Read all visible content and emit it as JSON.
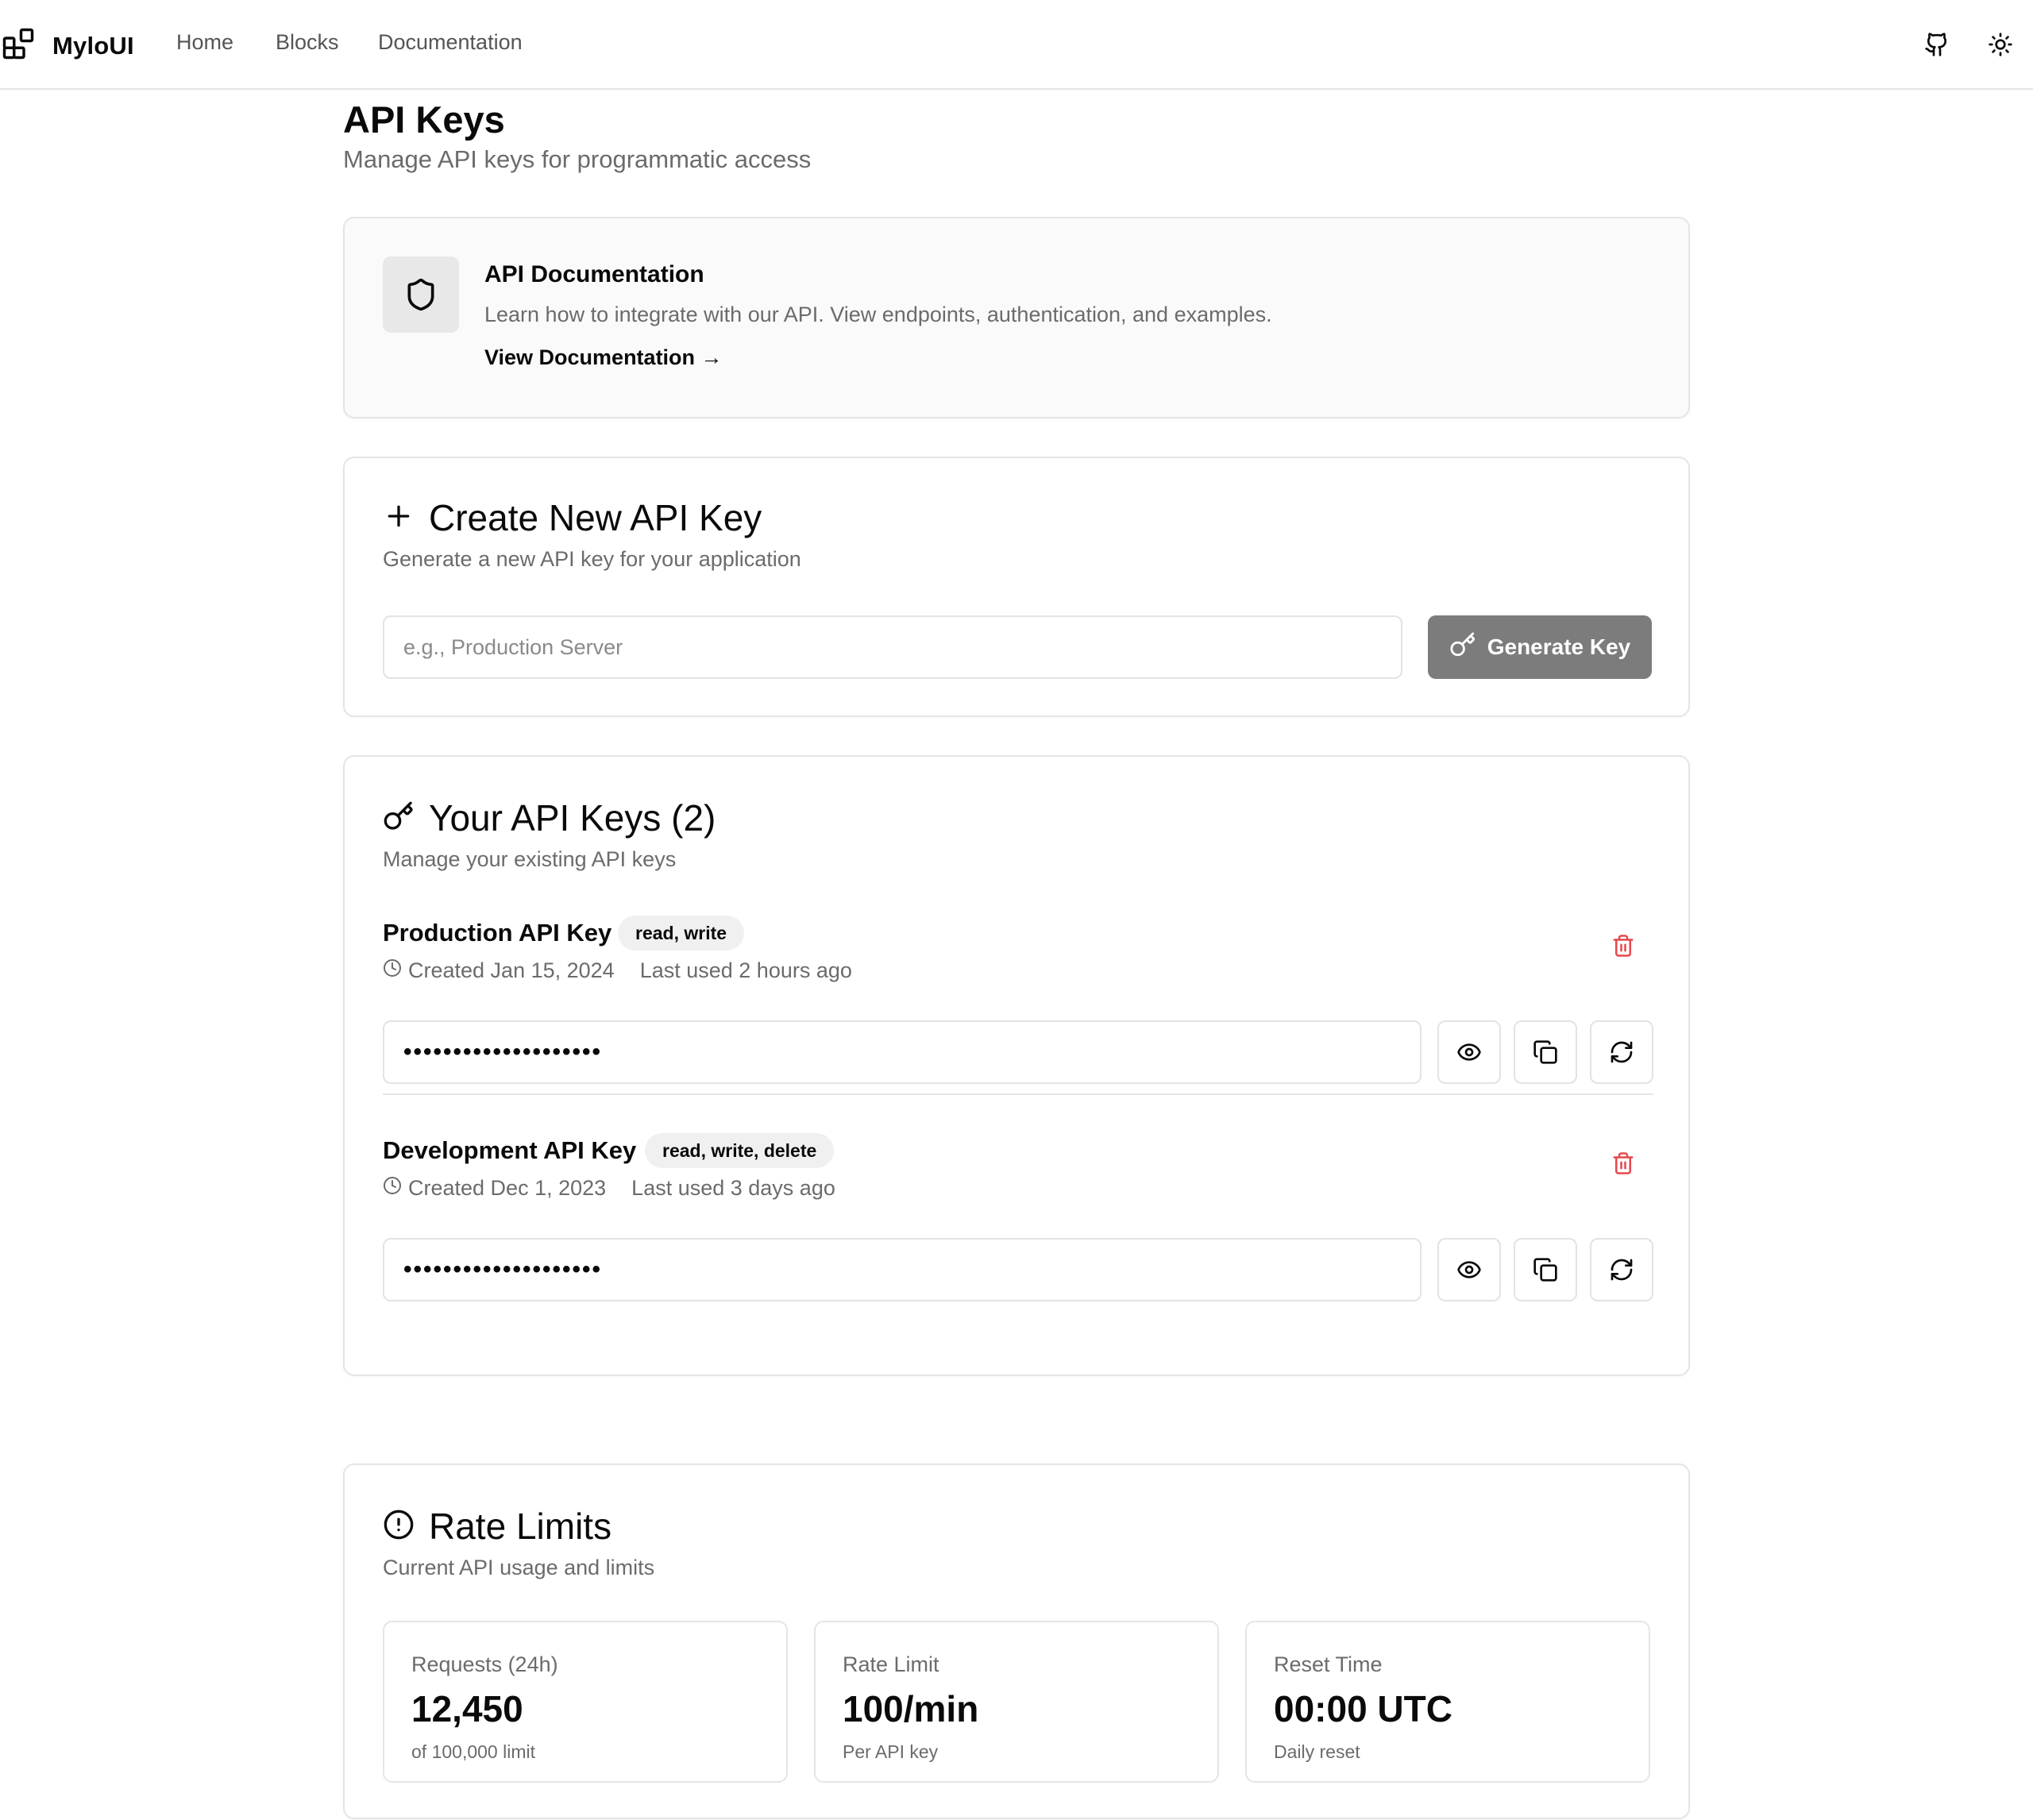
{
  "nav": {
    "brand": "MyloUI",
    "links": [
      "Home",
      "Blocks",
      "Documentation"
    ],
    "github_icon": "github-icon",
    "theme_icon": "sun-icon"
  },
  "page": {
    "title": "API Keys",
    "subtitle": "Manage API keys for programmatic access"
  },
  "docs_card": {
    "icon": "shield-icon",
    "title": "API Documentation",
    "description": "Learn how to integrate with our API. View endpoints, authentication, and examples.",
    "link": "View Documentation →"
  },
  "create_card": {
    "icon": "plus-icon",
    "title": "Create New API Key",
    "subtitle": "Generate a new API key for your application",
    "input_value": "",
    "input_placeholder": "e.g., Production Server",
    "button_icon": "key-icon",
    "button_label": "Generate Key",
    "button_color": "#7c7c7c"
  },
  "keys_card": {
    "icon": "key-icon",
    "title": "Your API Keys (2)",
    "subtitle": "Manage your existing API keys",
    "keys": [
      {
        "name": "Production API Key",
        "permissions": "read, write",
        "created": "Created Jan 15, 2024",
        "last_used": "Last used 2 hours ago",
        "masked_value": "••••••••••••••••••••"
      },
      {
        "name": "Development API Key",
        "permissions": "read, write, delete",
        "created": "Created Dec 1, 2023",
        "last_used": "Last used 3 days ago",
        "masked_value": "••••••••••••••••••••"
      }
    ],
    "delete_color": "#e5484d"
  },
  "rate_card": {
    "icon": "alert-circle-icon",
    "title": "Rate Limits",
    "subtitle": "Current API usage and limits",
    "stats": [
      {
        "label": "Requests (24h)",
        "value": "12,450",
        "note": "of 100,000 limit"
      },
      {
        "label": "Rate Limit",
        "value": "100/min",
        "note": "Per API key"
      },
      {
        "label": "Reset Time",
        "value": "00:00 UTC",
        "note": "Daily reset"
      }
    ]
  }
}
